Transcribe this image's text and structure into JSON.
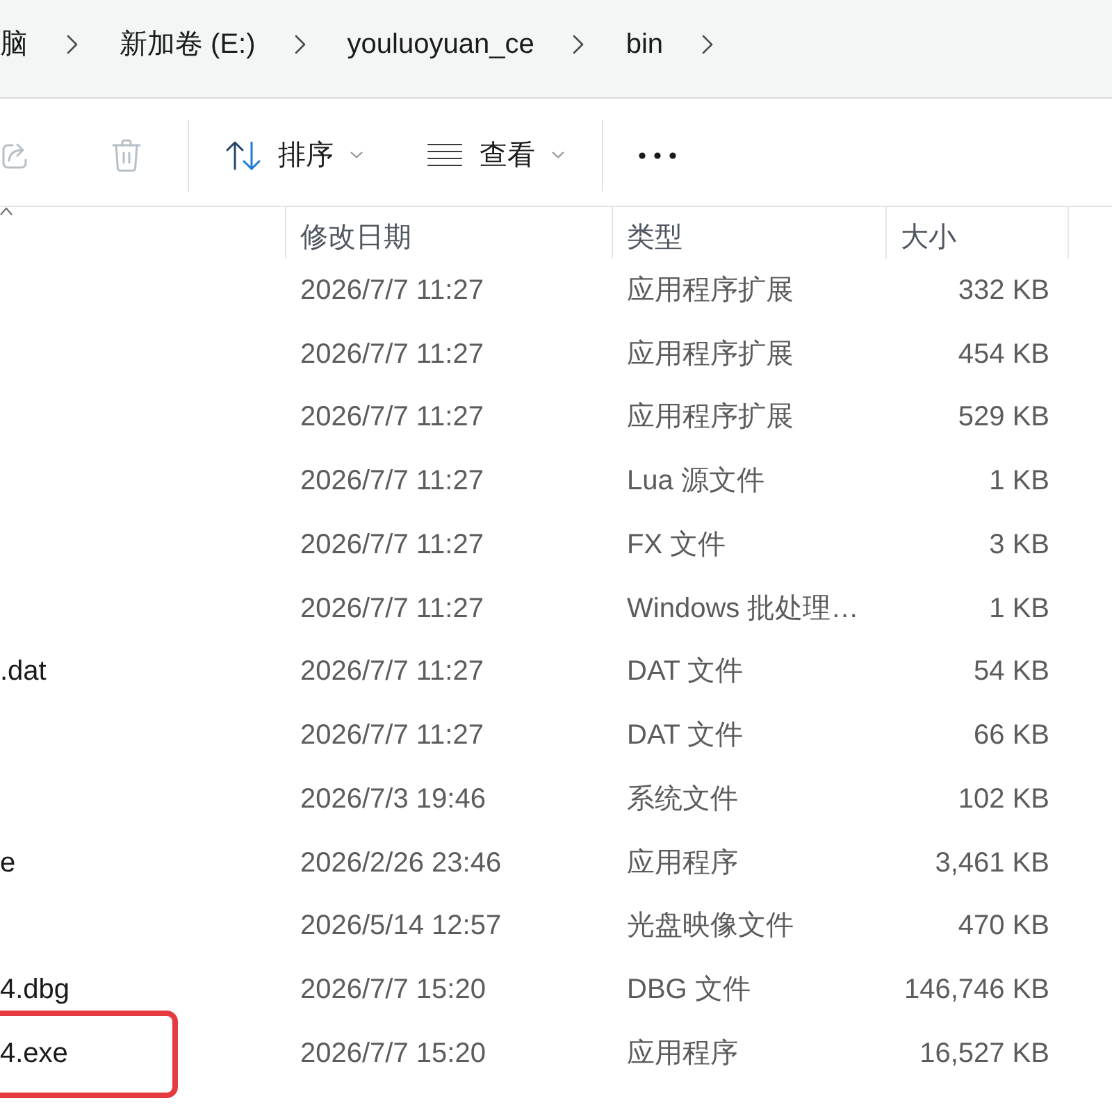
{
  "breadcrumb": {
    "items": [
      {
        "label": "脑"
      },
      {
        "label": "新加卷 (E:)"
      },
      {
        "label": "youluoyuan_ce"
      },
      {
        "label": "bin"
      }
    ]
  },
  "toolbar": {
    "groups": [
      [
        {
          "kind": "share",
          "disabled": true
        },
        {
          "kind": "delete",
          "disabled": true
        }
      ],
      [
        {
          "kind": "sort",
          "label": "排序",
          "disabled": false
        },
        {
          "kind": "view",
          "label": "查看",
          "disabled": false
        }
      ],
      [
        {
          "kind": "more",
          "disabled": false
        }
      ]
    ]
  },
  "file_list": {
    "columns": [
      {
        "kind": "name",
        "sorted": true
      },
      {
        "kind": "modified",
        "label": "修改日期",
        "sorted": false
      },
      {
        "kind": "type",
        "label": "类型",
        "sorted": false
      },
      {
        "kind": "size",
        "label": "大小",
        "sorted": false
      }
    ],
    "rows": [
      {
        "modified": "2026/7/7 11:27",
        "type": "应用程序扩展",
        "size": "332 KB",
        "highlighted": false
      },
      {
        "modified": "2026/7/7 11:27",
        "type": "应用程序扩展",
        "size": "454 KB",
        "highlighted": false
      },
      {
        "modified": "2026/7/7 11:27",
        "type": "应用程序扩展",
        "size": "529 KB",
        "highlighted": false
      },
      {
        "modified": "2026/7/7 11:27",
        "type": "Lua 源文件",
        "size": "1 KB",
        "highlighted": false
      },
      {
        "modified": "2026/7/7 11:27",
        "type": "FX 文件",
        "size": "3 KB",
        "highlighted": false
      },
      {
        "modified": "2026/7/7 11:27",
        "type": "Windows 批处理…",
        "size": "1 KB",
        "highlighted": false
      },
      {
        "name": ".dat",
        "modified": "2026/7/7 11:27",
        "type": "DAT 文件",
        "size": "54 KB",
        "highlighted": false
      },
      {
        "modified": "2026/7/7 11:27",
        "type": "DAT 文件",
        "size": "66 KB",
        "highlighted": false
      },
      {
        "modified": "2026/7/3 19:46",
        "type": "系统文件",
        "size": "102 KB",
        "highlighted": false
      },
      {
        "name": "e",
        "modified": "2026/2/26 23:46",
        "type": "应用程序",
        "size": "3,461 KB",
        "highlighted": false
      },
      {
        "modified": "2026/5/14 12:57",
        "type": "光盘映像文件",
        "size": "470 KB",
        "highlighted": false
      },
      {
        "name": "4.dbg",
        "modified": "2026/7/7 15:20",
        "type": "DBG 文件",
        "size": "146,746 KB",
        "highlighted": false
      },
      {
        "name": "4.exe",
        "modified": "2026/7/7 15:20",
        "type": "应用程序",
        "size": "16,527 KB",
        "highlighted": true
      }
    ]
  }
}
